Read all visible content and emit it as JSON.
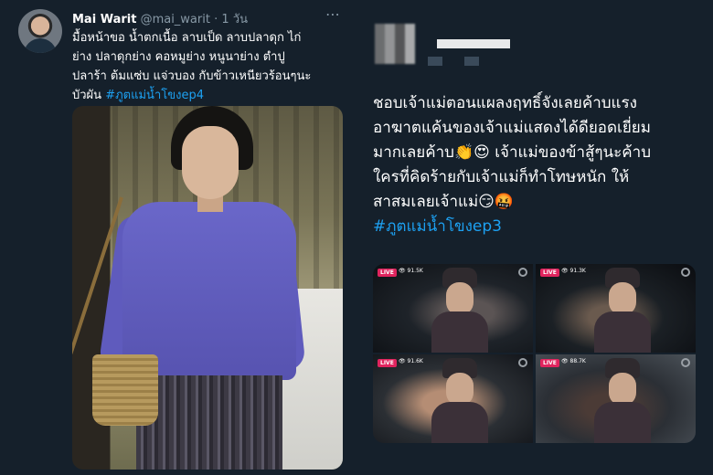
{
  "tweet_left": {
    "author_name": "Mai Warit",
    "author_handle": "@mai_warit",
    "separator": " · ",
    "time": "1 วัน",
    "more": "⋯",
    "text_lines": [
      "มื้อหน้าขอ น้ำตกเนื้อ ลาบเป็ด ลาบปลาดุก ไก่",
      "ย่าง ปลาดุกย่าง คอหมูย่าง หนูนาย่าง ตำปู",
      "ปลาร้า ต้มแซ่บ แจ่วบอง กับข้าวเหนียวร้อนๆนะ"
    ],
    "last_line_text": "บัวผัน ",
    "hashtag": "#ภูตแม่น้ำโขงep4"
  },
  "tweet_right": {
    "text_lines": [
      "ชอบเจ้าแม่ตอนแผลงฤทธิ์จังเลยค้าบแรง",
      "อาฆาตแค้นของเจ้าแม่แสดงได้ดียอดเยี่ยม",
      "มากเลยค้าบ👏😍 เจ้าแม่ของข้าสู้ๆนะค้าบ",
      "ใครที่คิดร้ายกับเจ้าแม่ก็ทำโทษหนัก ให้",
      "สาสมเลยเจ้าแม่😏🤬"
    ],
    "hashtag": "#ภูตแม่น้ำโขงep3",
    "thumbnails": [
      {
        "live": "LIVE",
        "views": "91.5K"
      },
      {
        "live": "LIVE",
        "views": "91.3K"
      },
      {
        "live": "LIVE",
        "views": "91.6K"
      },
      {
        "live": "LIVE",
        "views": "88.7K"
      }
    ]
  },
  "colors": {
    "background": "#15202b",
    "hashtag": "#1da1f2",
    "secondary_text": "#8899a6",
    "live_badge": "#e0245e"
  },
  "icons": [
    "more-icon",
    "eye-icon",
    "channel-logo-icon"
  ]
}
